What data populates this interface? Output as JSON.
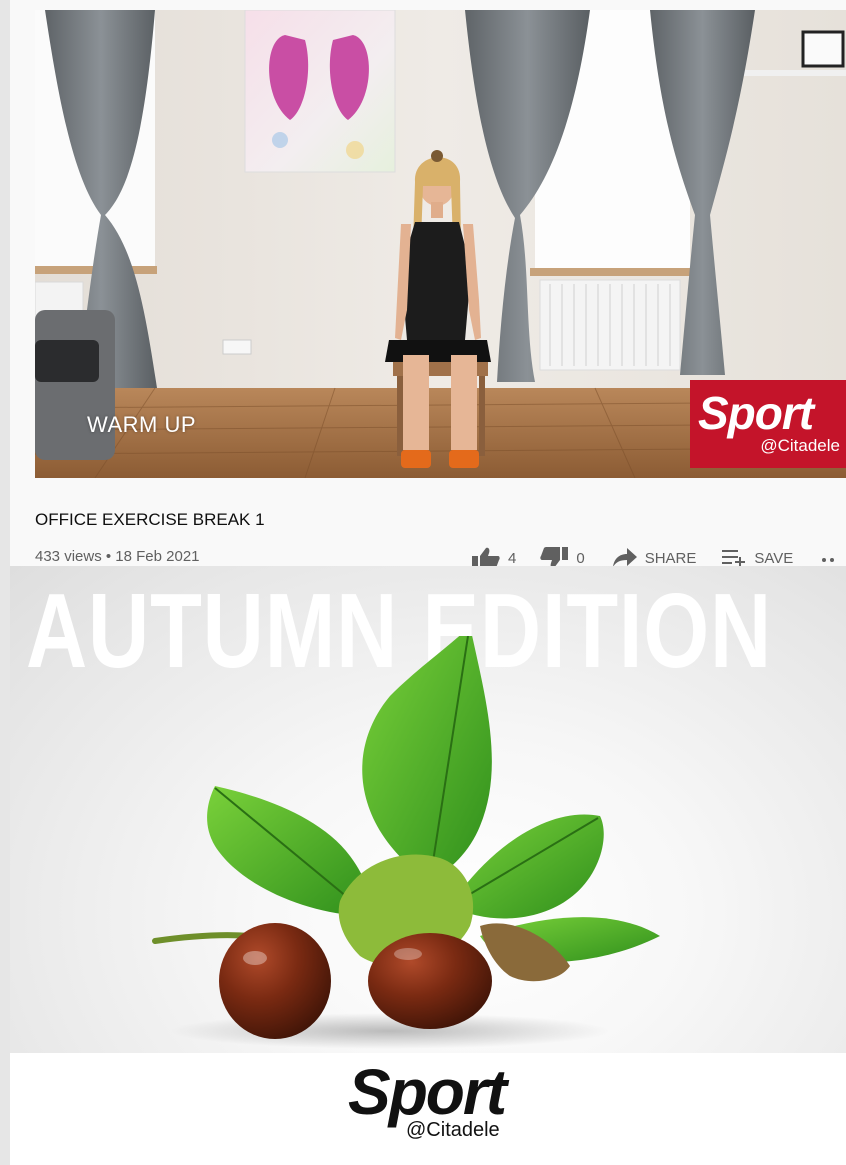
{
  "video": {
    "overlay_label": "WARM UP",
    "badge_word": "Sport",
    "badge_sub": "@Citadele",
    "title": "OFFICE EXERCISE BREAK 1",
    "meta": "433 views • 18 Feb 2021",
    "likes": "4",
    "dislikes": "0",
    "share_label": "SHARE",
    "save_label": "SAVE",
    "icons": [
      "thumbs-up-icon",
      "thumbs-down-icon",
      "share-icon",
      "save-playlist-icon",
      "more-icon"
    ],
    "colors": {
      "badge": "#c4142a",
      "meta_text": "#606060",
      "title_text": "#0f0f0f"
    }
  },
  "autumn": {
    "heading": "AUTUMN EDITION",
    "logo_word": "Sport",
    "logo_sub": "@Citadele"
  }
}
